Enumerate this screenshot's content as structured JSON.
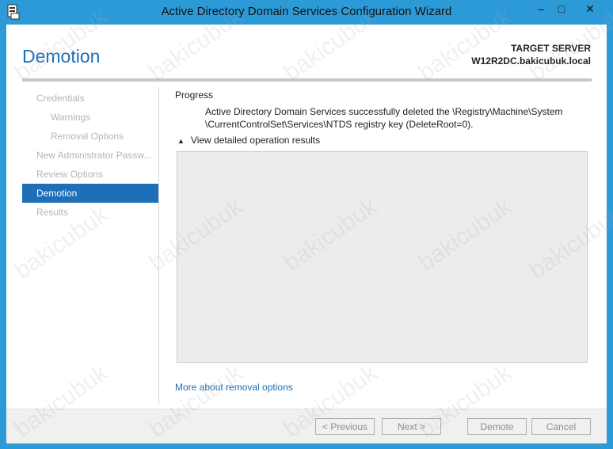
{
  "window": {
    "title": "Active Directory Domain Services Configuration Wizard",
    "minimize_glyph": "–",
    "maximize_glyph": "□",
    "close_glyph": "✕"
  },
  "header": {
    "page_title": "Demotion",
    "target_label": "TARGET SERVER",
    "target_name": "W12R2DC.bakicubuk.local"
  },
  "nav": {
    "items": [
      {
        "label": "Credentials",
        "level": 0,
        "state": "disabled"
      },
      {
        "label": "Warnings",
        "level": 1,
        "state": "disabled"
      },
      {
        "label": "Removal Options",
        "level": 1,
        "state": "disabled"
      },
      {
        "label": "New Administrator Passw...",
        "level": 0,
        "state": "disabled"
      },
      {
        "label": "Review Options",
        "level": 0,
        "state": "disabled"
      },
      {
        "label": "Demotion",
        "level": 0,
        "state": "active"
      },
      {
        "label": "Results",
        "level": 0,
        "state": "disabled"
      }
    ]
  },
  "content": {
    "progress_label": "Progress",
    "progress_line1": "Active Directory Domain Services successfully deleted the \\Registry\\Machine\\System",
    "progress_line2": "\\CurrentControlSet\\Services\\NTDS registry key (DeleteRoot=0).",
    "toggle_label": "View detailed operation results",
    "more_link": "More about removal options"
  },
  "footer": {
    "previous": "< Previous",
    "next": "Next >",
    "demote": "Demote",
    "cancel": "Cancel"
  },
  "watermark": "bakicubuk",
  "colors": {
    "titlebar": "#2d9ad8",
    "accent": "#1d6fb8",
    "disabled_text": "#b5b5b5"
  }
}
